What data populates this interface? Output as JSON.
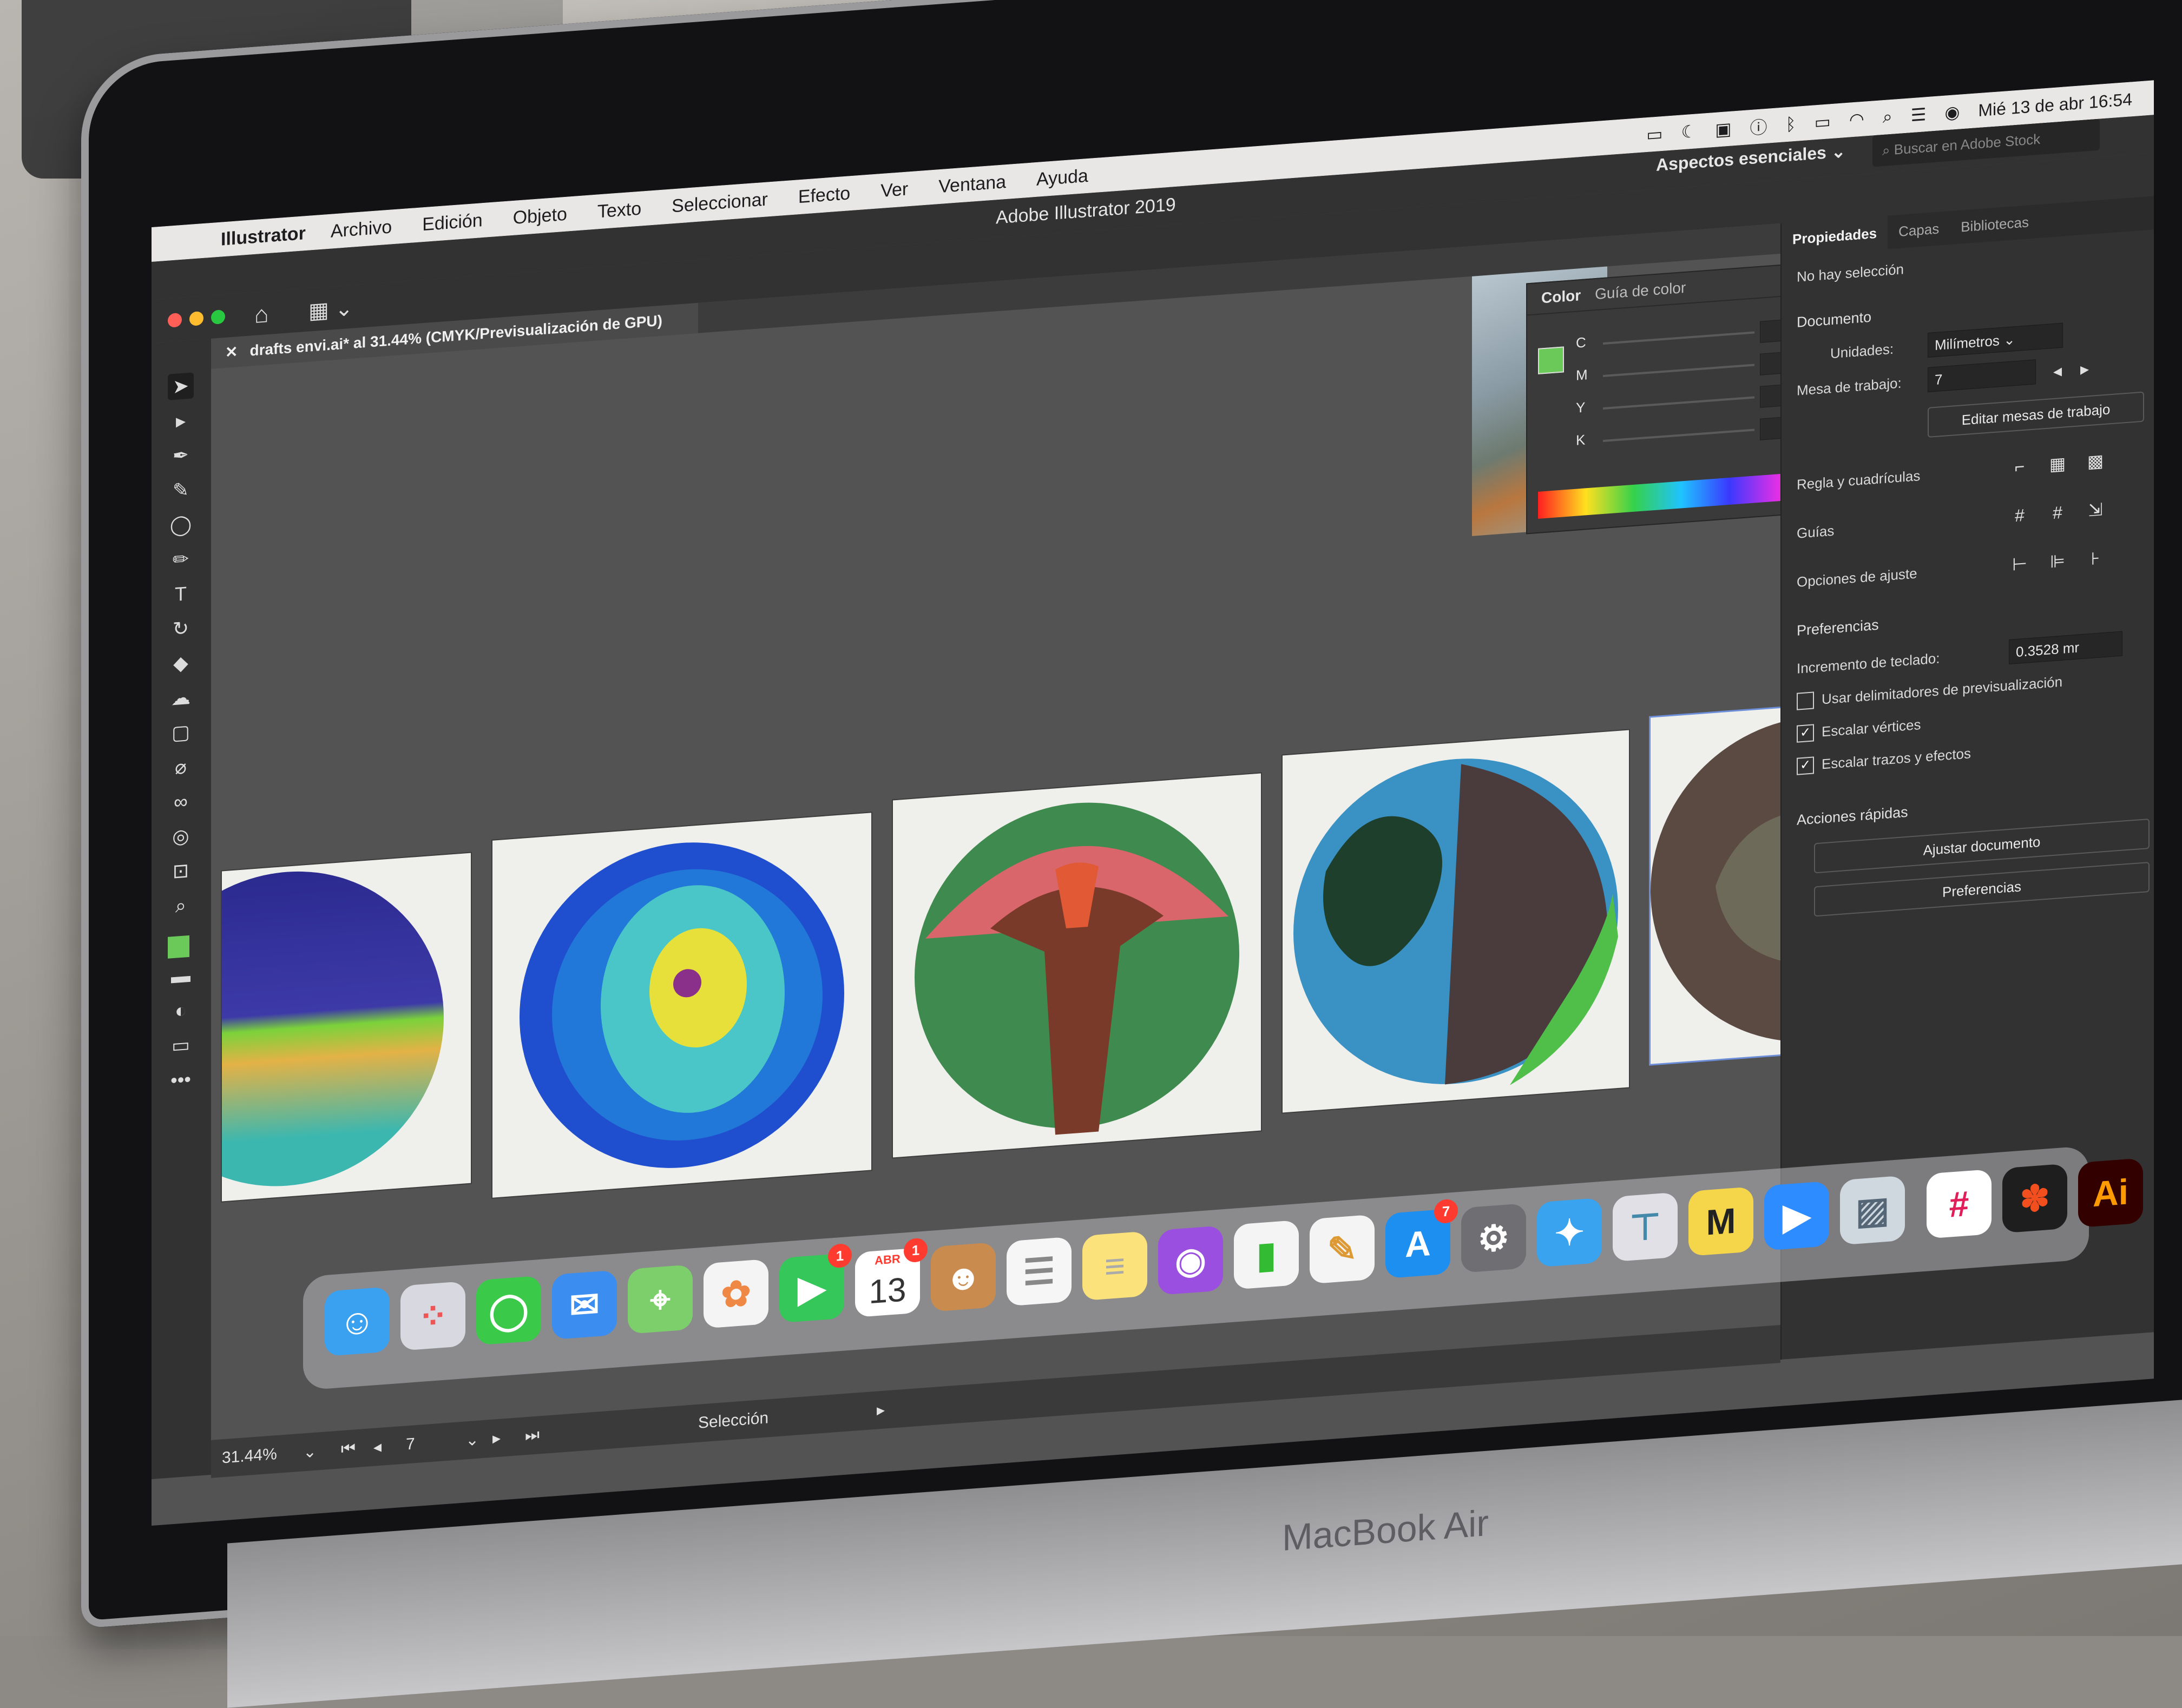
{
  "menubar": {
    "app_name": "Illustrator",
    "items": [
      "Archivo",
      "Edición",
      "Objeto",
      "Texto",
      "Seleccionar",
      "Efecto",
      "Ver",
      "Ventana",
      "Ayuda"
    ],
    "status_icons": [
      "display-icon",
      "moon-icon",
      "la-icon",
      "info-icon",
      "bluetooth-icon",
      "battery-icon",
      "wifi-icon",
      "spotlight-icon",
      "control-center-icon",
      "siri-icon"
    ],
    "clock": "Mié 13 de abr  16:54"
  },
  "window": {
    "title": "Adobe Illustrator 2019",
    "workspace": "Aspectos esenciales",
    "search_placeholder": "Buscar en Adobe Stock",
    "document_tab": "drafts envi.ai* al 31.44% (CMYK/Previsualización de GPU)"
  },
  "color_panel": {
    "tab_color": "Color",
    "tab_guide": "Guía de color",
    "channels": [
      "C",
      "M",
      "Y",
      "K"
    ],
    "percent": "%"
  },
  "properties": {
    "tabs": [
      "Propiedades",
      "Capas",
      "Bibliotecas"
    ],
    "no_selection": "No hay selección",
    "document_heading": "Documento",
    "units_label": "Unidades:",
    "units_value": "Milímetros",
    "artboard_label": "Mesa de trabajo:",
    "artboard_value": "7",
    "edit_artboards": "Editar mesas de trabajo",
    "rulers_label": "Regla y cuadrículas",
    "guides_label": "Guías",
    "snap_label": "Opciones de ajuste",
    "preferences_heading": "Preferencias",
    "keyboard_increment_label": "Incremento de teclado:",
    "keyboard_increment_value": "0.3528 mr",
    "checkbox_preview_bounds": "Usar delimitadores de previsualización",
    "checkbox_scale_corners": "Escalar vértices",
    "checkbox_scale_strokes": "Escalar trazos y efectos",
    "quick_actions_heading": "Acciones rápidas",
    "fit_document": "Ajustar documento",
    "preferences_button": "Preferencias"
  },
  "statusbar": {
    "zoom": "31.44%",
    "artboard_number": "7",
    "tool_name": "Selección"
  },
  "dock": {
    "calendar_month": "ABR",
    "calendar_day": "13",
    "facetime_badge": "1",
    "calendar_badge": "1",
    "appstore_badge": "7",
    "illustrator_label": "Ai"
  },
  "laptop": {
    "brand": "MacBook Air"
  },
  "colors": {
    "ui_dark": "#323232",
    "canvas": "#535353",
    "fill_swatch": "#6bc95a",
    "selection_blue": "#6c8ed8"
  }
}
